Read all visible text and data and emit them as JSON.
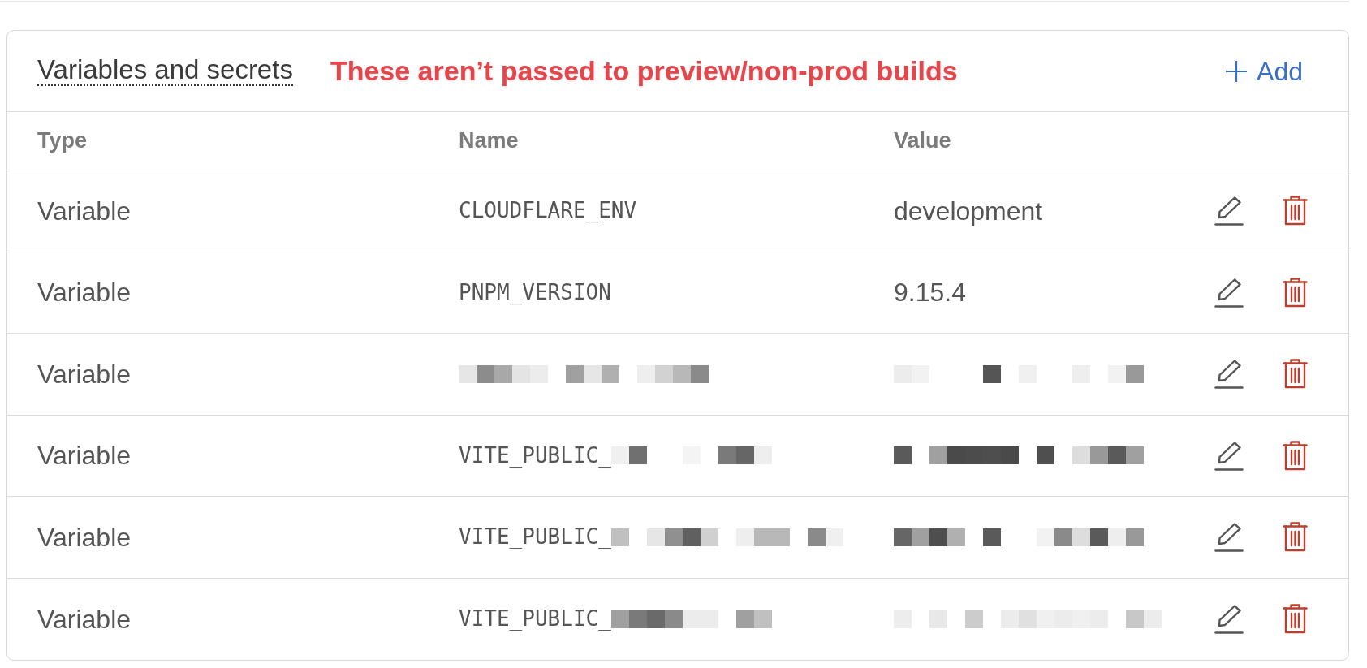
{
  "card": {
    "title": "Variables and secrets",
    "annotation": "These aren’t passed to preview/non-prod builds",
    "add_button": "Add"
  },
  "table": {
    "columns": [
      "Type",
      "Name",
      "Value"
    ],
    "rows": [
      {
        "type": "Variable",
        "name": "CLOUDFLARE_ENV",
        "name_redacted": false,
        "value": "development",
        "value_redacted": false
      },
      {
        "type": "Variable",
        "name": "PNPM_VERSION",
        "name_redacted": false,
        "value": "9.15.4",
        "value_redacted": false
      },
      {
        "type": "Variable",
        "name_redacted": true,
        "value_redacted": true
      },
      {
        "type": "Variable",
        "name": "VITE_PUBLIC_",
        "name_redacted": true,
        "value_redacted": true
      },
      {
        "type": "Variable",
        "name": "VITE_PUBLIC_",
        "name_redacted": true,
        "value_redacted": true
      },
      {
        "type": "Variable",
        "name": "VITE_PUBLIC_",
        "name_redacted": true,
        "value_redacted": true
      }
    ]
  }
}
